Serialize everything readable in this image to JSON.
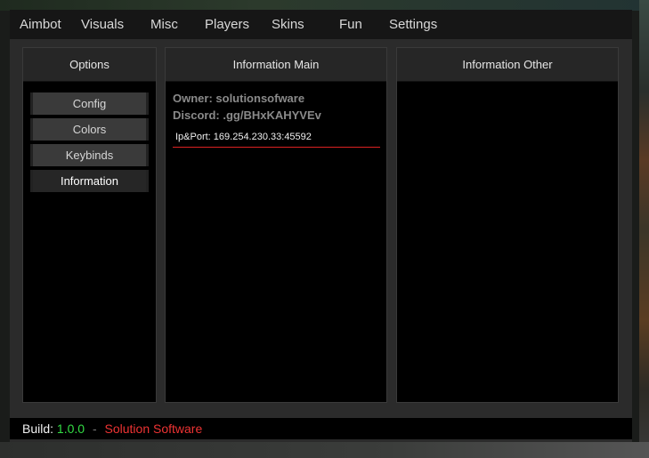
{
  "colors": {
    "accent_red": "#ee3333",
    "version_green": "#33dd44",
    "underline_red": "#dd2222"
  },
  "menubar": {
    "items": [
      {
        "label": "Aimbot"
      },
      {
        "label": "Visuals"
      },
      {
        "label": "Misc"
      },
      {
        "label": "Players"
      },
      {
        "label": "Skins"
      },
      {
        "label": "Fun"
      },
      {
        "label": "Settings"
      }
    ]
  },
  "options_panel": {
    "title": "Options",
    "buttons": [
      {
        "label": "Config"
      },
      {
        "label": "Colors"
      },
      {
        "label": "Keybinds"
      },
      {
        "label": "Information",
        "active": true
      }
    ]
  },
  "info_main": {
    "title": "Information Main",
    "owner": "Owner: solutionsofware",
    "discord": "Discord: .gg/BHxKAHYVEv",
    "ip_port": "Ip&Port: 169.254.230.33:45592"
  },
  "info_other": {
    "title": "Information Other"
  },
  "statusbar": {
    "build_label": "Build:",
    "version": "1.0.0",
    "separator": "-",
    "brand": "Solution Software"
  }
}
